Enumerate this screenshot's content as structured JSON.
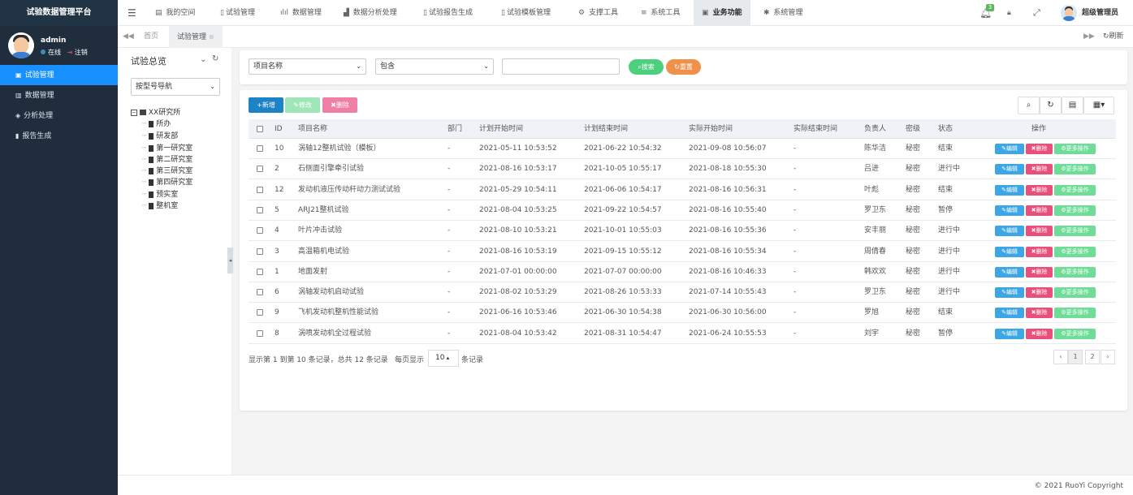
{
  "app": {
    "title": "试验数据管理平台"
  },
  "user": {
    "name": "admin",
    "status": "在线",
    "logout": "注销",
    "top_name": "超级管理员",
    "notif_count": "3"
  },
  "sidebar": {
    "items": [
      {
        "label": "试验管理",
        "icon": "square-icon",
        "active": true
      },
      {
        "label": "数据管理",
        "icon": "bar-chart-icon"
      },
      {
        "label": "分析处理",
        "icon": "cube-icon"
      },
      {
        "label": "报告生成",
        "icon": "bookmark-icon"
      }
    ]
  },
  "topnav": {
    "items": [
      {
        "label": "我的空间"
      },
      {
        "label": "试验管理"
      },
      {
        "label": "数据管理"
      },
      {
        "label": "数据分析处理"
      },
      {
        "label": "试验报告生成"
      },
      {
        "label": "试验模板管理"
      },
      {
        "label": "支撑工具"
      },
      {
        "label": "系统工具"
      },
      {
        "label": "业务功能",
        "active": true
      },
      {
        "label": "系统管理"
      }
    ]
  },
  "tabs": {
    "home": "首页",
    "active": "试验管理",
    "refresh": "刷新"
  },
  "tree": {
    "title": "试验总览",
    "nav_select": "按型号导航",
    "root": "XX研究所",
    "children": [
      "所办",
      "研发部",
      "第一研究室",
      "第二研究室",
      "第三研究室",
      "第四研究室",
      "预实室",
      "整机室"
    ]
  },
  "search": {
    "field_select": "项目名称",
    "op_select": "包含",
    "value": "",
    "search_btn": "搜索",
    "reset_btn": "重置"
  },
  "toolbar": {
    "add": "新增",
    "edit": "修改",
    "delete": "删除"
  },
  "table": {
    "headers": [
      "ID",
      "项目名称",
      "部门",
      "计划开始时间",
      "计划结束时间",
      "实际开始时间",
      "实际结束时间",
      "负责人",
      "密级",
      "状态",
      "操作"
    ],
    "rows": [
      {
        "id": "10",
        "name": "涡轴12整机试验（模板）",
        "dept": "-",
        "plan_start": "2021-05-11 10:53:52",
        "plan_end": "2021-06-22 10:54:32",
        "act_start": "2021-09-08 10:56:07",
        "act_end": "-",
        "owner": "陈华洁",
        "secret": "秘密",
        "status": "结束"
      },
      {
        "id": "2",
        "name": "石侧面引擎牵引试验",
        "dept": "-",
        "plan_start": "2021-08-16 10:53:17",
        "plan_end": "2021-10-05 10:55:17",
        "act_start": "2021-08-18 10:55:30",
        "act_end": "-",
        "owner": "吕进",
        "secret": "秘密",
        "status": "进行中"
      },
      {
        "id": "12",
        "name": "发动机液压传动杆动力测试试验",
        "dept": "-",
        "plan_start": "2021-05-29 10:54:11",
        "plan_end": "2021-06-06 10:54:17",
        "act_start": "2021-08-16 10:56:31",
        "act_end": "-",
        "owner": "叶彪",
        "secret": "秘密",
        "status": "结束"
      },
      {
        "id": "5",
        "name": "ARJ21整机试验",
        "dept": "-",
        "plan_start": "2021-08-04 10:53:25",
        "plan_end": "2021-09-22 10:54:57",
        "act_start": "2021-08-16 10:55:40",
        "act_end": "-",
        "owner": "罗卫东",
        "secret": "秘密",
        "status": "暂停"
      },
      {
        "id": "4",
        "name": "叶片冲击试验",
        "dept": "-",
        "plan_start": "2021-08-10 10:53:21",
        "plan_end": "2021-10-01 10:55:03",
        "act_start": "2021-08-16 10:55:36",
        "act_end": "-",
        "owner": "安丰丽",
        "secret": "秘密",
        "status": "进行中"
      },
      {
        "id": "3",
        "name": "高温箱机电试验",
        "dept": "-",
        "plan_start": "2021-08-16 10:53:19",
        "plan_end": "2021-09-15 10:55:12",
        "act_start": "2021-08-16 10:55:34",
        "act_end": "-",
        "owner": "周倩春",
        "secret": "秘密",
        "status": "进行中"
      },
      {
        "id": "1",
        "name": "地面发射",
        "dept": "-",
        "plan_start": "2021-07-01 00:00:00",
        "plan_end": "2021-07-07 00:00:00",
        "act_start": "2021-08-16 10:46:33",
        "act_end": "-",
        "owner": "韩欢欢",
        "secret": "秘密",
        "status": "进行中"
      },
      {
        "id": "6",
        "name": "涡轴发动机启动试验",
        "dept": "-",
        "plan_start": "2021-08-02 10:53:29",
        "plan_end": "2021-08-26 10:53:33",
        "act_start": "2021-07-14 10:55:43",
        "act_end": "-",
        "owner": "罗卫东",
        "secret": "秘密",
        "status": "进行中"
      },
      {
        "id": "9",
        "name": "飞机发动机整机性能试验",
        "dept": "-",
        "plan_start": "2021-06-16 10:53:46",
        "plan_end": "2021-06-30 10:54:38",
        "act_start": "2021-06-30 10:56:00",
        "act_end": "-",
        "owner": "罗旭",
        "secret": "秘密",
        "status": "结束"
      },
      {
        "id": "8",
        "name": "涡喷发动机全过程试验",
        "dept": "-",
        "plan_start": "2021-08-04 10:53:42",
        "plan_end": "2021-08-31 10:54:47",
        "act_start": "2021-06-24 10:55:53",
        "act_end": "-",
        "owner": "刘宇",
        "secret": "秘密",
        "status": "暂停"
      }
    ],
    "action_edit": "编辑",
    "action_delete": "删除",
    "action_more": "更多操作"
  },
  "pagination": {
    "summary": "显示第 1 到第 10 条记录，总共 12 条记录",
    "per_page_prefix": "每页显示",
    "per_page": "10",
    "per_page_suffix": "条记录",
    "prev": "‹",
    "page1": "1",
    "page2": "2",
    "next": "›"
  },
  "footer": {
    "copyright": "© 2021 RuoYi Copyright"
  },
  "colors": {
    "sidebar": "#1f2d3d",
    "primary": "#1890ff",
    "success": "#5cd08a",
    "warning": "#f0914b",
    "danger": "#e84f7a",
    "info": "#3da7e6"
  }
}
